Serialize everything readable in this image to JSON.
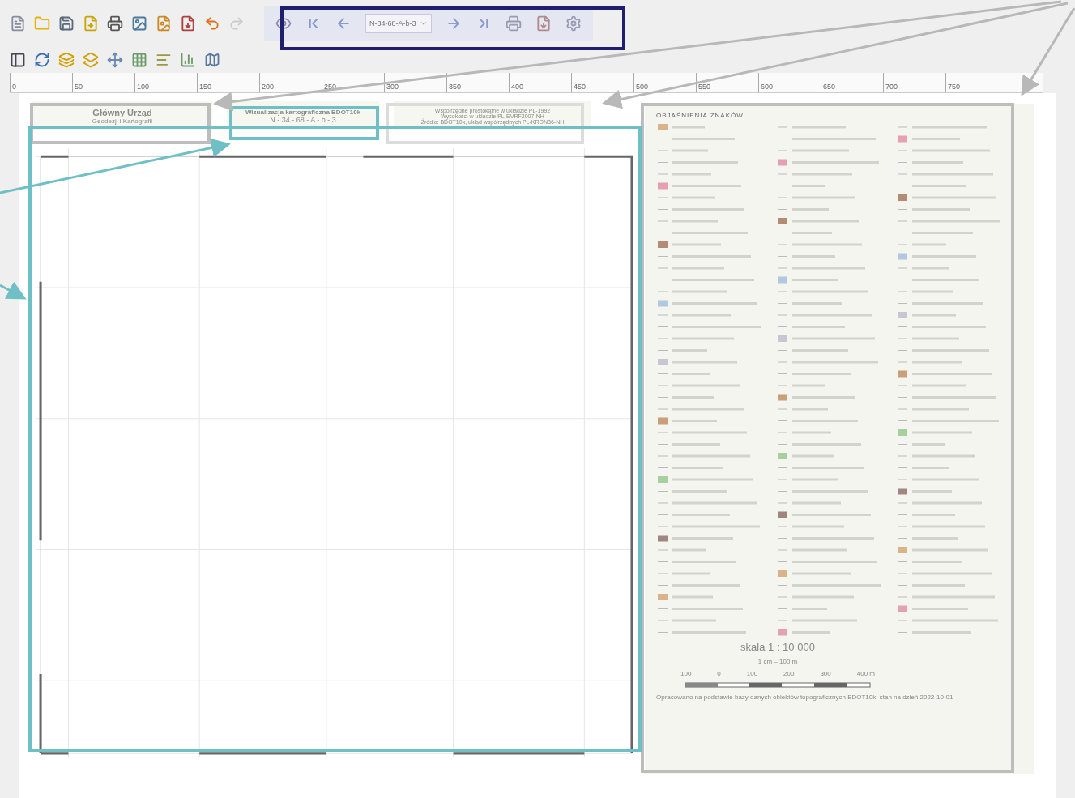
{
  "atlas_toolbar": {
    "page_combo": "N-34-68-A-b-3"
  },
  "ruler": {
    "ticks": [
      "0",
      "50",
      "100",
      "150",
      "200",
      "250",
      "300",
      "350",
      "400",
      "450",
      "500",
      "550",
      "600",
      "650",
      "700",
      "750"
    ]
  },
  "map_header": {
    "left": {
      "title": "Główny Urząd",
      "subtitle": "Geodezji i Kartografii"
    },
    "center": {
      "title": "Wizualizacja kartograficzna BDOT10k",
      "sheet": "N - 34 - 68 - A - b - 3"
    },
    "right": {
      "lines": [
        "Współrzędne prostokątne w układzie PL-1992",
        "Wysokości w układzie PL-EVRF2007-NH",
        "Źródło: BDOT10k, układ współrzędnych PL-KRON86-NH"
      ]
    }
  },
  "legend": {
    "title": "OBJAŚNIENIA ZNAKÓW",
    "scale": "skala 1 : 10 000",
    "unit": "1 cm – 100 m",
    "scalebar_labels": [
      "100",
      "0",
      "100",
      "200",
      "300",
      "400 m"
    ],
    "footnote": "Opracowano na podstawie bazy danych obiektów topograficznych BDOT10k, stan na dzień 2022-10-01"
  }
}
